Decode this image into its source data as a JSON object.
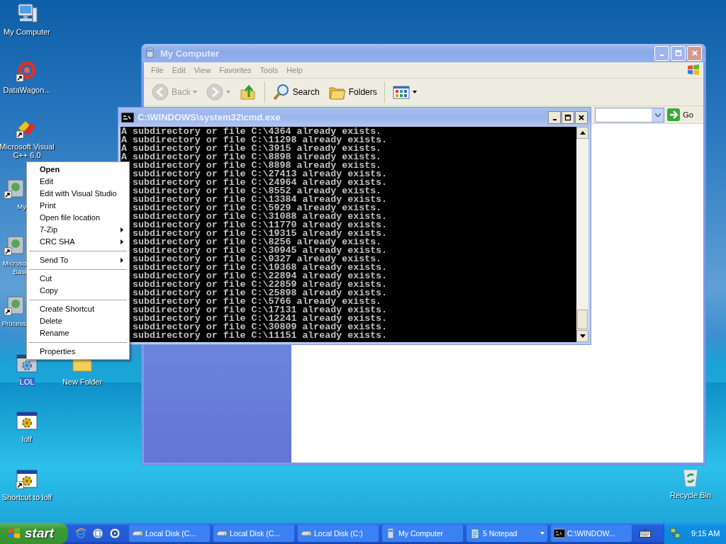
{
  "desktop_icons": [
    {
      "label": "My Computer",
      "kind": "computer",
      "shortcut": false,
      "selected": false
    },
    {
      "label": "DataWagon...",
      "kind": "dots",
      "shortcut": true,
      "selected": false
    },
    {
      "label": "Microsoft Visual C++ 6.0",
      "kind": "colorful",
      "shortcut": true,
      "selected": false
    },
    {
      "label": "My",
      "kind": "program",
      "shortcut": true,
      "selected": false
    },
    {
      "label": "Microso Basi",
      "kind": "program",
      "shortcut": true,
      "selected": false
    },
    {
      "label": "Process",
      "kind": "program",
      "shortcut": true,
      "selected": false
    },
    {
      "label": "LOL",
      "kind": "gearwin",
      "shortcut": false,
      "selected": true
    },
    {
      "label": "New Folder",
      "kind": "folder",
      "shortcut": false,
      "selected": false
    },
    {
      "label": "lolf",
      "kind": "gearwin",
      "shortcut": false,
      "selected": false
    },
    {
      "label": "Shortcut to lolf",
      "kind": "gearwin",
      "shortcut": true,
      "selected": false
    },
    {
      "label": "Recycle Bin",
      "kind": "recycle",
      "shortcut": false,
      "selected": false
    }
  ],
  "explorer": {
    "title": "My Computer",
    "menu": [
      "File",
      "Edit",
      "View",
      "Favorites",
      "Tools",
      "Help"
    ],
    "toolbar": [
      {
        "kind": "back",
        "label": "Back",
        "disabled": true,
        "dropdown": true
      },
      {
        "kind": "forward",
        "disabled": true,
        "dropdown": true
      },
      {
        "kind": "up",
        "disabled": false,
        "dropdown": false
      },
      {
        "kind": "search",
        "label": "Search",
        "disabled": false,
        "dropdown": false
      },
      {
        "kind": "folders",
        "label": "Folders",
        "disabled": false,
        "dropdown": false
      },
      {
        "kind": "views",
        "disabled": false,
        "dropdown": true
      }
    ],
    "go": "Go"
  },
  "console": {
    "title": "C:\\WINDOWS\\system32\\cmd.exe",
    "lines": [
      {
        "prefix": "A",
        "text": "subdirectory or file C:\\4364 already exists."
      },
      {
        "prefix": "A",
        "text": "subdirectory or file C:\\11298 already exists."
      },
      {
        "prefix": "A",
        "text": "subdirectory or file C:\\3915 already exists."
      },
      {
        "prefix": "A",
        "text": "subdirectory or file C:\\8898 already exists."
      },
      {
        "text": "subdirectory or file C:\\8898 already exists."
      },
      {
        "text": "subdirectory or file C:\\27413 already exists."
      },
      {
        "text": "subdirectory or file C:\\24964 already exists."
      },
      {
        "text": "subdirectory or file C:\\8552 already exists."
      },
      {
        "text": "subdirectory or file C:\\13384 already exists."
      },
      {
        "text": "subdirectory or file C:\\5929 already exists."
      },
      {
        "text": "subdirectory or file C:\\31088 already exists."
      },
      {
        "text": "subdirectory or file C:\\11770 already exists."
      },
      {
        "text": "subdirectory or file C:\\19315 already exists."
      },
      {
        "text": "subdirectory or file C:\\8256 already exists."
      },
      {
        "text": "subdirectory or file C:\\30945 already exists."
      },
      {
        "text": "subdirectory or file C:\\9327 already exists."
      },
      {
        "text": "subdirectory or file C:\\19368 already exists."
      },
      {
        "text": "subdirectory or file C:\\22894 already exists."
      },
      {
        "text": "subdirectory or file C:\\22859 already exists."
      },
      {
        "text": "subdirectory or file C:\\25898 already exists."
      },
      {
        "text": "subdirectory or file C:\\5766 already exists."
      },
      {
        "text": "subdirectory or file C:\\17131 already exists."
      },
      {
        "text": "subdirectory or file C:\\12241 already exists."
      },
      {
        "text": "subdirectory or file C:\\30809 already exists."
      },
      {
        "text": "subdirectory or file C:\\11151 already exists."
      }
    ]
  },
  "context_menu": [
    {
      "kind": "default",
      "label": "Open"
    },
    {
      "kind": "item",
      "label": "Edit"
    },
    {
      "kind": "item",
      "label": "Edit with Visual Studio"
    },
    {
      "kind": "item",
      "label": "Print"
    },
    {
      "kind": "item",
      "label": "Open file location"
    },
    {
      "kind": "submenu",
      "label": "7-Zip"
    },
    {
      "kind": "submenu",
      "label": "CRC SHA"
    },
    {
      "kind": "separator"
    },
    {
      "kind": "submenu",
      "label": "Send To"
    },
    {
      "kind": "separator"
    },
    {
      "kind": "item",
      "label": "Cut"
    },
    {
      "kind": "item",
      "label": "Copy"
    },
    {
      "kind": "separator"
    },
    {
      "kind": "item",
      "label": "Create Shortcut"
    },
    {
      "kind": "item",
      "label": "Delete"
    },
    {
      "kind": "item",
      "label": "Rename"
    },
    {
      "kind": "separator"
    },
    {
      "kind": "item",
      "label": "Properties"
    }
  ],
  "taskbar": {
    "start": "start",
    "tasks": [
      {
        "kind": "drive",
        "label": "Local Disk (C...",
        "grouped": false
      },
      {
        "kind": "drive",
        "label": "Local Disk (C...",
        "grouped": false
      },
      {
        "kind": "drive",
        "label": "Local Disk (C:)",
        "grouped": false
      },
      {
        "kind": "computer",
        "label": "My Computer",
        "grouped": false
      },
      {
        "kind": "notepad",
        "label": "5 Notepad",
        "grouped": true
      },
      {
        "kind": "console",
        "label": "C:\\WINDOW...",
        "grouped": false
      }
    ],
    "clock": "9:15 AM"
  }
}
